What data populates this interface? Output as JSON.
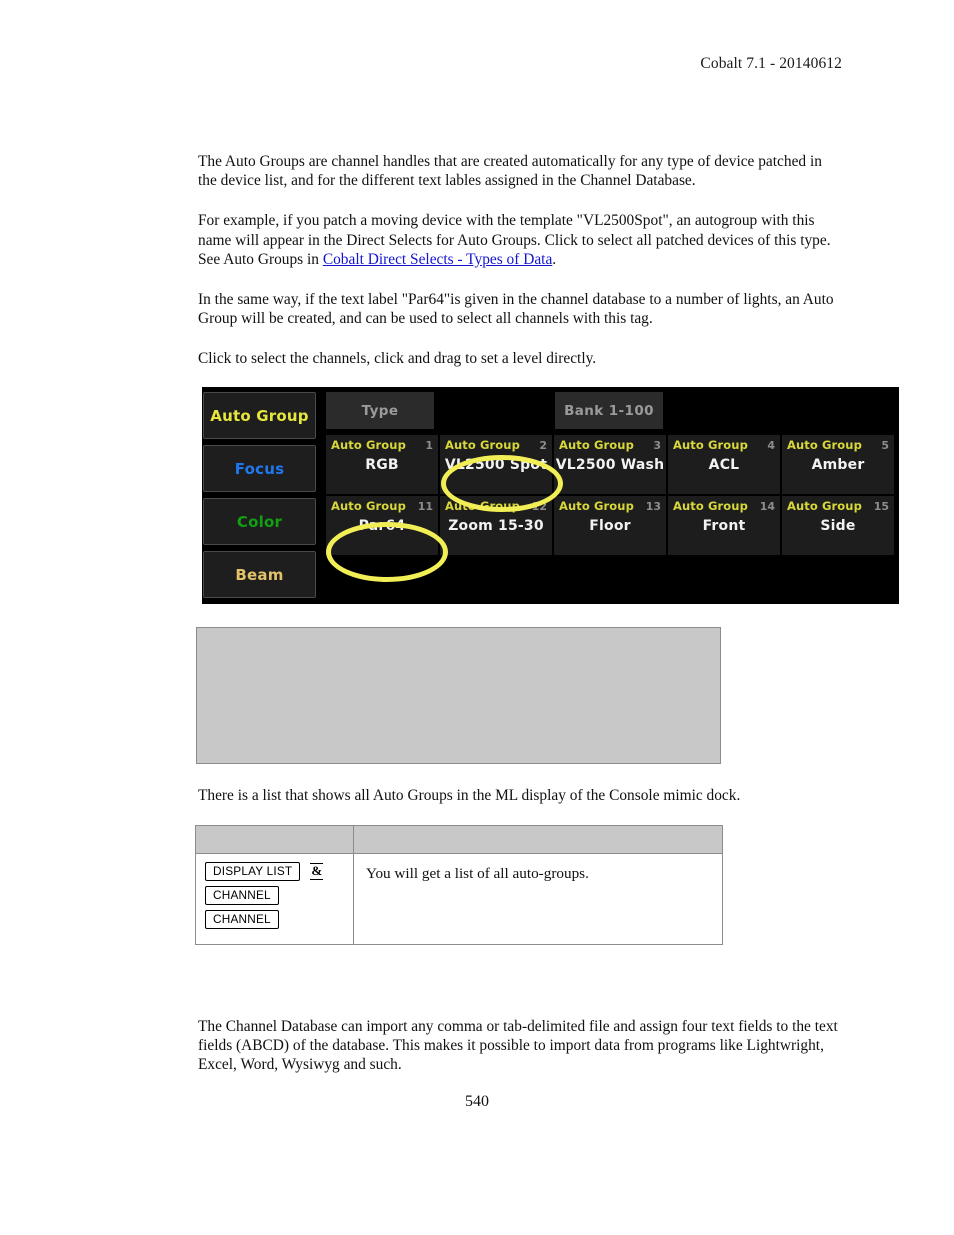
{
  "header": {
    "version_line": "Cobalt 7.1 - 20140612"
  },
  "body": {
    "paragraph_1": "The Auto Groups are channel handles that are created automatically for any type of device patched in the device list, and for the different text lables assigned in the Channel Database.",
    "paragraph_2_before_link": "For example, if you patch a moving device with the template \"VL2500Spot\", an autogroup with this name will appear in the Direct Selects for Auto Groups. Click to select all patched devices of this type. See Auto Groups in ",
    "paragraph_2_link": "Cobalt Direct Selects - Types of Data",
    "paragraph_2_after_link": ".",
    "paragraph_3": "In the same way, if the text label \"Par64\"is given in the channel database to a number of lights, an Auto Group will be created, and can be used to select all channels with this tag.",
    "paragraph_4": "Click to select the channels, click and drag to set a level directly.",
    "caption": "There is a list that shows all Auto Groups in the ML display of the Console mimic dock.",
    "paragraph_5": "The Channel Database can import any comma or tab-delimited file and assign four text fields to the text fields (ABCD) of the database. This makes it possible to import data from programs like Lightwright, Excel, Word, Wysiwyg and such."
  },
  "console": {
    "side_buttons": [
      {
        "label": "Auto Group",
        "color": "#e6e63c"
      },
      {
        "label": "Focus",
        "color": "#1f78f0"
      },
      {
        "label": "Color",
        "color": "#12a012"
      },
      {
        "label": "Beam",
        "color": "#e3c26a"
      }
    ],
    "tabs": {
      "type": "Type",
      "bank": "Bank 1-100"
    },
    "cell_kind_label": "Auto Group",
    "rows": [
      [
        {
          "number": "1",
          "label": "RGB"
        },
        {
          "number": "2",
          "label": "VL2500 Spot"
        },
        {
          "number": "3",
          "label": "VL2500 Wash"
        },
        {
          "number": "4",
          "label": "ACL"
        },
        {
          "number": "5",
          "label": "Amber"
        }
      ],
      [
        {
          "number": "11",
          "label": "Par64"
        },
        {
          "number": "12",
          "label": "Zoom 15-30"
        },
        {
          "number": "13",
          "label": "Floor"
        },
        {
          "number": "14",
          "label": "Front"
        },
        {
          "number": "15",
          "label": "Side"
        }
      ]
    ],
    "highlight_color": "#f2ee56",
    "highlighted_cells": [
      "VL2500 Spot",
      "Par64"
    ]
  },
  "key_table": {
    "header_left": "",
    "header_right": "",
    "keys": [
      {
        "cap": "DISPLAY LIST",
        "suffix": "&"
      },
      {
        "cap": "CHANNEL",
        "suffix": ""
      },
      {
        "cap": "CHANNEL",
        "suffix": ""
      }
    ],
    "description": "You will get a list of all auto-groups."
  },
  "footer": {
    "page_number": "540"
  }
}
